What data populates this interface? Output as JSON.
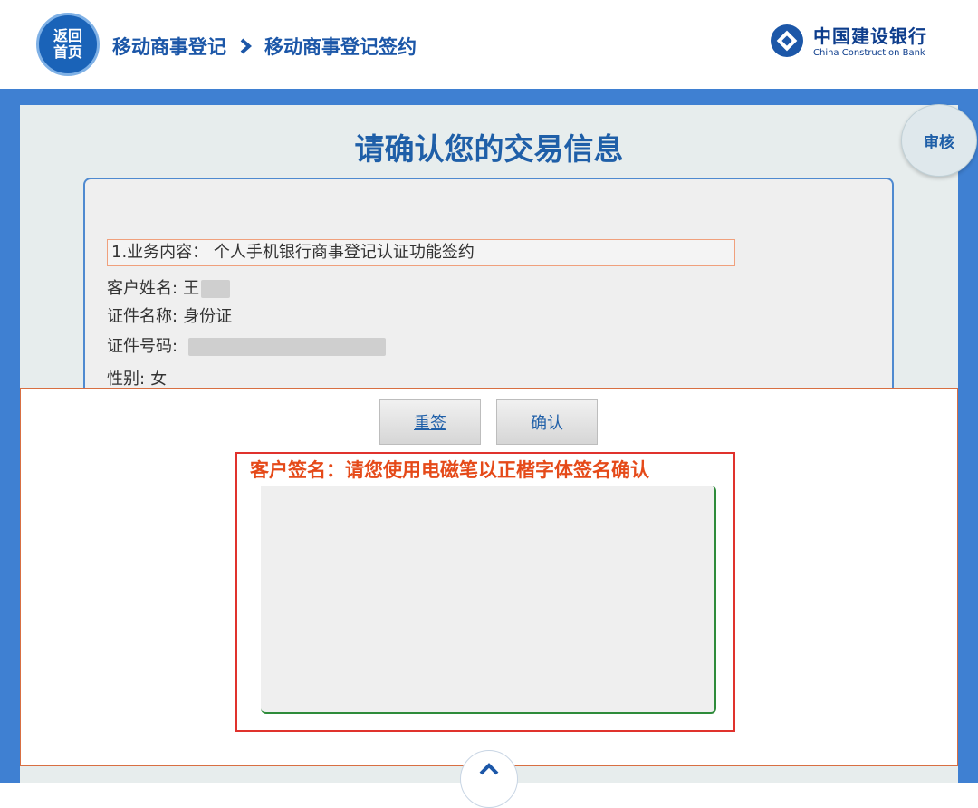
{
  "header": {
    "home_line1": "返回",
    "home_line2": "首页",
    "breadcrumb": [
      "移动商事登记",
      "移动商事登记签约"
    ],
    "bank_name_cn": "中国建设银行",
    "bank_name_en": "China Construction Bank"
  },
  "page": {
    "title": "请确认您的交易信息",
    "audit_label": "审核"
  },
  "info": {
    "business_label": "1.业务内容：",
    "business_value": "个人手机银行商事登记认证功能签约",
    "name_label": "客户姓名:",
    "name_value": "王",
    "id_type_label": "证件名称:",
    "id_type_value": "身份证",
    "id_number_label": "证件号码:",
    "gender_label": "性别:",
    "gender_value": "女"
  },
  "signature": {
    "resign_label": "重签",
    "confirm_label": "确认",
    "instruction": "客户签名：请您使用电磁笔以正楷字体签名确认"
  },
  "colors": {
    "brand_blue": "#1c57a8",
    "frame_blue": "#3f80d2",
    "accent_orange": "#e54a19",
    "border_red": "#e0322d",
    "canvas_green": "#2e8b3a"
  }
}
